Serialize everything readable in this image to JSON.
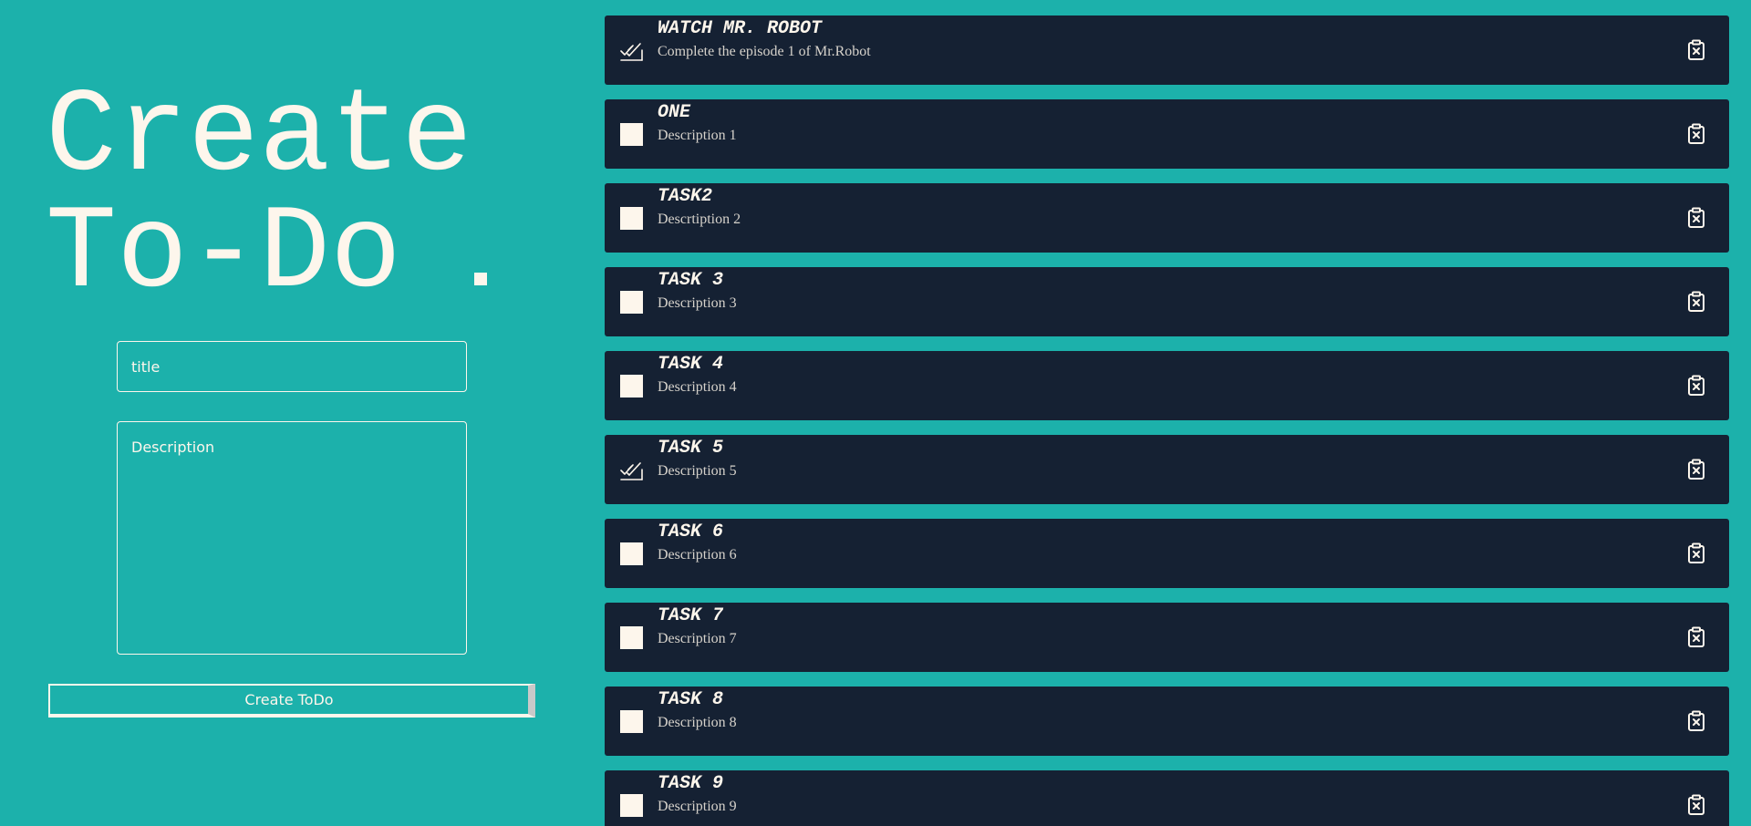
{
  "form": {
    "headline_line1": "Create",
    "headline_line2": "To-Do",
    "headline_dot": ".",
    "title_placeholder": "title",
    "description_placeholder": "Description",
    "submit_label": "Create ToDo"
  },
  "colors": {
    "background": "#1cb1ab",
    "card": "#152133",
    "text": "#fdf6ec"
  },
  "tasks": [
    {
      "title": "WATCH MR. ROBOT",
      "description": "Complete the episode 1 of Mr.Robot",
      "done": true
    },
    {
      "title": "ONE",
      "description": "Description 1",
      "done": false
    },
    {
      "title": "TASK2",
      "description": "Descrtiption 2",
      "done": false
    },
    {
      "title": "TASK 3",
      "description": "Description 3",
      "done": false
    },
    {
      "title": "TASK 4",
      "description": "Description 4",
      "done": false
    },
    {
      "title": "TASK 5",
      "description": "Description 5",
      "done": true
    },
    {
      "title": "TASK 6",
      "description": "Description 6",
      "done": false
    },
    {
      "title": "TASK 7",
      "description": "Description 7",
      "done": false
    },
    {
      "title": "TASK 8",
      "description": "Description 8",
      "done": false
    },
    {
      "title": "TASK 9",
      "description": "Description 9",
      "done": false
    }
  ],
  "icons": {
    "done": "double-check-icon",
    "not_done": "checkbox-icon",
    "delete": "clipboard-delete-icon"
  }
}
